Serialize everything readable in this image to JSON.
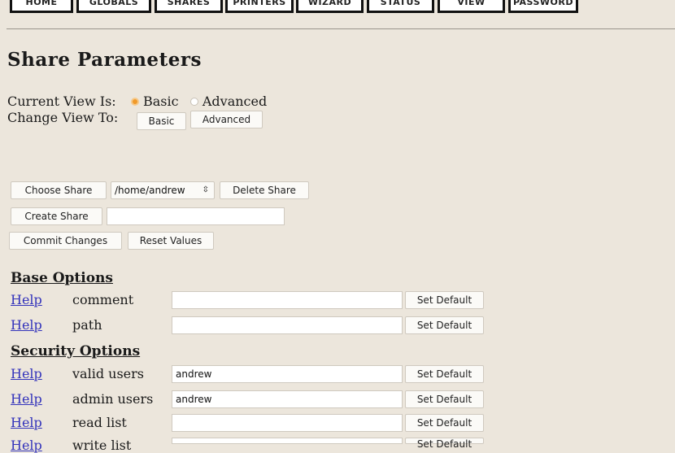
{
  "nav": {
    "tabs": [
      "HOME",
      "GLOBALS",
      "SHARES",
      "PRINTERS",
      "WIZARD",
      "STATUS",
      "VIEW",
      "PASSWORD"
    ]
  },
  "page_title": "Share Parameters",
  "view": {
    "current_label": "Current View Is:",
    "option_basic": "Basic",
    "option_advanced": "Advanced",
    "selected": "Basic",
    "change_label": "Change View To:",
    "btn_basic": "Basic",
    "btn_advanced": "Advanced"
  },
  "share_controls": {
    "choose_share": "Choose Share",
    "share_select_value": "/home/andrew",
    "delete_share": "Delete Share",
    "create_share": "Create Share",
    "create_share_value": "",
    "commit_changes": "Commit Changes",
    "reset_values": "Reset Values"
  },
  "base_options": {
    "heading": "Base Options",
    "rows": [
      {
        "help": "Help",
        "name": "comment",
        "value": "",
        "btn": "Set Default"
      },
      {
        "help": "Help",
        "name": "path",
        "value": "",
        "btn": "Set Default"
      }
    ]
  },
  "security_options": {
    "heading": "Security Options",
    "rows": [
      {
        "help": "Help",
        "name": "valid users",
        "value": "andrew",
        "btn": "Set Default"
      },
      {
        "help": "Help",
        "name": "admin users",
        "value": "andrew",
        "btn": "Set Default"
      },
      {
        "help": "Help",
        "name": "read list",
        "value": "",
        "btn": "Set Default"
      },
      {
        "help": "Help",
        "name": "write list",
        "value": "",
        "btn": "Set Default"
      }
    ]
  },
  "colors": {
    "background": "#ece6dc",
    "radio_selected": "#f09a2a",
    "link": "#3333bb"
  }
}
